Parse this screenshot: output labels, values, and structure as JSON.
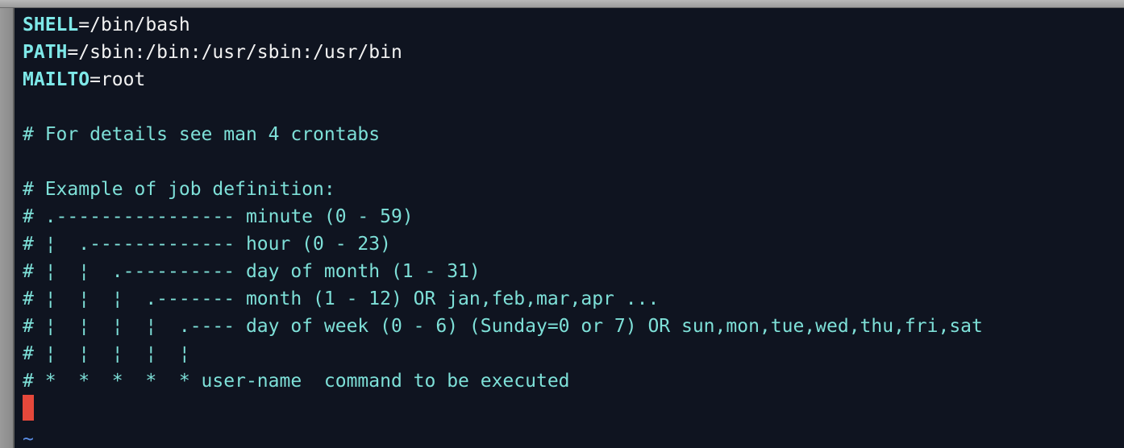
{
  "terminal": {
    "vars": [
      {
        "name": "SHELL",
        "eq": "=",
        "value": "/bin/bash"
      },
      {
        "name": "PATH",
        "eq": "=",
        "value": "/sbin:/bin:/usr/sbin:/usr/bin"
      },
      {
        "name": "MAILTO",
        "eq": "=",
        "value": "root"
      }
    ],
    "comments": [
      "# For details see man 4 crontabs",
      "# Example of job definition:",
      "# .---------------- minute (0 - 59)",
      "# ¦  .------------- hour (0 - 23)",
      "# ¦  ¦  .---------- day of month (1 - 31)",
      "# ¦  ¦  ¦  .------- month (1 - 12) OR jan,feb,mar,apr ...",
      "# ¦  ¦  ¦  ¦  .---- day of week (0 - 6) (Sunday=0 or 7) OR sun,mon,tue,wed,thu,fri,sat",
      "# ¦  ¦  ¦  ¦  ¦",
      "# *  *  *  *  * user-name  command to be executed"
    ],
    "empty_line_marker": "~",
    "colors": {
      "background": "#0f1420",
      "variable": "#7ee8e8",
      "comment": "#7ee0d8",
      "cursor": "#e5483b",
      "tilde": "#5b8fe8"
    }
  }
}
